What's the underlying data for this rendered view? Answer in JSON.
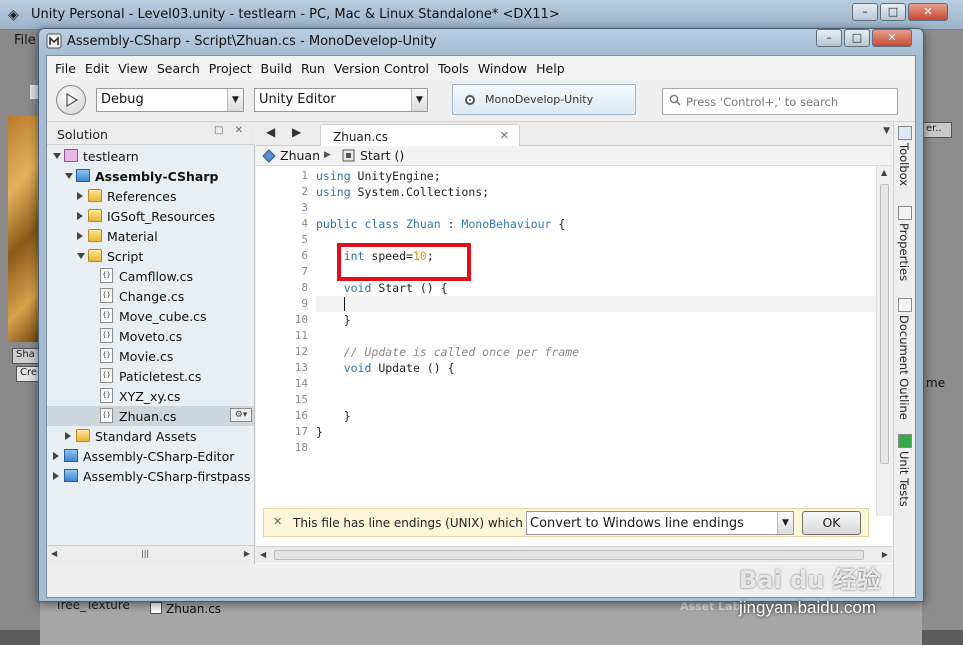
{
  "unity": {
    "title": "Unity Personal - Level03.unity - testlearn - PC, Mac & Linux Standalone* <DX11>",
    "file_menu": "File",
    "tree_texture": "Tree_Texture",
    "bottom_file": "Zhuan.cs",
    "asset_labels": "Asset Lab",
    "right_snippet": "me",
    "right_box": "er..",
    "left_tab": "Sha",
    "left_tab2": "Cre",
    "controls": {
      "minimize": "–",
      "maximize": "□",
      "close": "✕"
    }
  },
  "monodevelop": {
    "title": "Assembly-CSharp - Script\\Zhuan.cs - MonoDevelop-Unity",
    "controls": {
      "minimize": "–",
      "maximize": "□",
      "close": "✕"
    },
    "menu": [
      "File",
      "Edit",
      "View",
      "Search",
      "Project",
      "Build",
      "Run",
      "Version Control",
      "Tools",
      "Window",
      "Help"
    ],
    "toolbar": {
      "config": "Debug",
      "target": "Unity Editor",
      "status": "MonoDevelop-Unity",
      "search_placeholder": "Press 'Control+,' to search"
    },
    "solution": {
      "title": "Solution",
      "pad_buttons": "□ ✕",
      "tree": [
        {
          "label": "testlearn",
          "kind": "solution",
          "expander": "open"
        },
        {
          "label": "Assembly-CSharp",
          "kind": "project",
          "expander": "open",
          "bold": true
        },
        {
          "label": "References",
          "kind": "folder",
          "expander": "closed"
        },
        {
          "label": "IGSoft_Resources",
          "kind": "folder",
          "expander": "closed"
        },
        {
          "label": "Material",
          "kind": "folder",
          "expander": "closed"
        },
        {
          "label": "Script",
          "kind": "folder",
          "expander": "open"
        },
        {
          "label": "Camfllow.cs",
          "kind": "file"
        },
        {
          "label": "Change.cs",
          "kind": "file"
        },
        {
          "label": "Move_cube.cs",
          "kind": "file"
        },
        {
          "label": "Moveto.cs",
          "kind": "file"
        },
        {
          "label": "Movie.cs",
          "kind": "file"
        },
        {
          "label": "Paticletest.cs",
          "kind": "file"
        },
        {
          "label": "XYZ_xy.cs",
          "kind": "file"
        },
        {
          "label": "Zhuan.cs",
          "kind": "file",
          "selected": true
        },
        {
          "label": "Standard Assets",
          "kind": "folder",
          "expander": "closed"
        },
        {
          "label": "Assembly-CSharp-Editor",
          "kind": "project",
          "expander": "closed"
        },
        {
          "label": "Assembly-CSharp-firstpass",
          "kind": "project",
          "expander": "closed"
        }
      ],
      "file_icon_text": "{}",
      "row_gear": "⚙▾"
    },
    "editor": {
      "tab_label": "Zhuan.cs",
      "tab_close": "✕",
      "breadcrumb": {
        "class": "Zhuan",
        "method": "Start ()"
      },
      "line_numbers": [
        "1",
        "2",
        "3",
        "4",
        "5",
        "6",
        "7",
        "8",
        "9",
        "10",
        "11",
        "12",
        "13",
        "14",
        "15",
        "16",
        "17",
        "18"
      ],
      "code": [
        [
          {
            "t": "using",
            "c": "kw"
          },
          {
            "t": " UnityEngine;"
          }
        ],
        [
          {
            "t": "using",
            "c": "kw"
          },
          {
            "t": " System.Collections;"
          }
        ],
        [],
        [
          {
            "t": "public",
            "c": "kw"
          },
          {
            "t": " "
          },
          {
            "t": "class",
            "c": "kw"
          },
          {
            "t": " "
          },
          {
            "t": "Zhuan",
            "c": "ty"
          },
          {
            "t": " : "
          },
          {
            "t": "MonoBehaviour",
            "c": "ty"
          },
          {
            "t": " {"
          }
        ],
        [],
        [
          {
            "t": "    "
          },
          {
            "t": "int",
            "c": "kw"
          },
          {
            "t": " speed="
          },
          {
            "t": "10",
            "c": "num"
          },
          {
            "t": ";"
          }
        ],
        [],
        [
          {
            "t": "    "
          },
          {
            "t": "void",
            "c": "kw"
          },
          {
            "t": " Start () {"
          }
        ],
        [],
        [
          {
            "t": "    }"
          }
        ],
        [],
        [
          {
            "t": "    "
          },
          {
            "t": "// Update is called once per frame",
            "c": "cm"
          }
        ],
        [
          {
            "t": "    "
          },
          {
            "t": "void",
            "c": "kw"
          },
          {
            "t": " Update () {"
          }
        ],
        [],
        [],
        [
          {
            "t": "    }"
          }
        ],
        [
          {
            "t": "}"
          }
        ],
        []
      ],
      "current_line": 9
    },
    "infobar": {
      "close": "✕",
      "message": "This file has line endings (UNIX) which d...",
      "option": "Convert to Windows line endings",
      "ok": "OK"
    },
    "dock": [
      "Toolbox",
      "Properties",
      "Document Outline",
      "Unit Tests"
    ]
  },
  "watermark": {
    "brand": "Bai du 经验",
    "url": "jingyan.baidu.com"
  },
  "colors": {
    "keyword": "#2f6fb0",
    "number": "#f0870c",
    "comment": "#8a8a8a",
    "highlight_box": "#e0101a"
  }
}
